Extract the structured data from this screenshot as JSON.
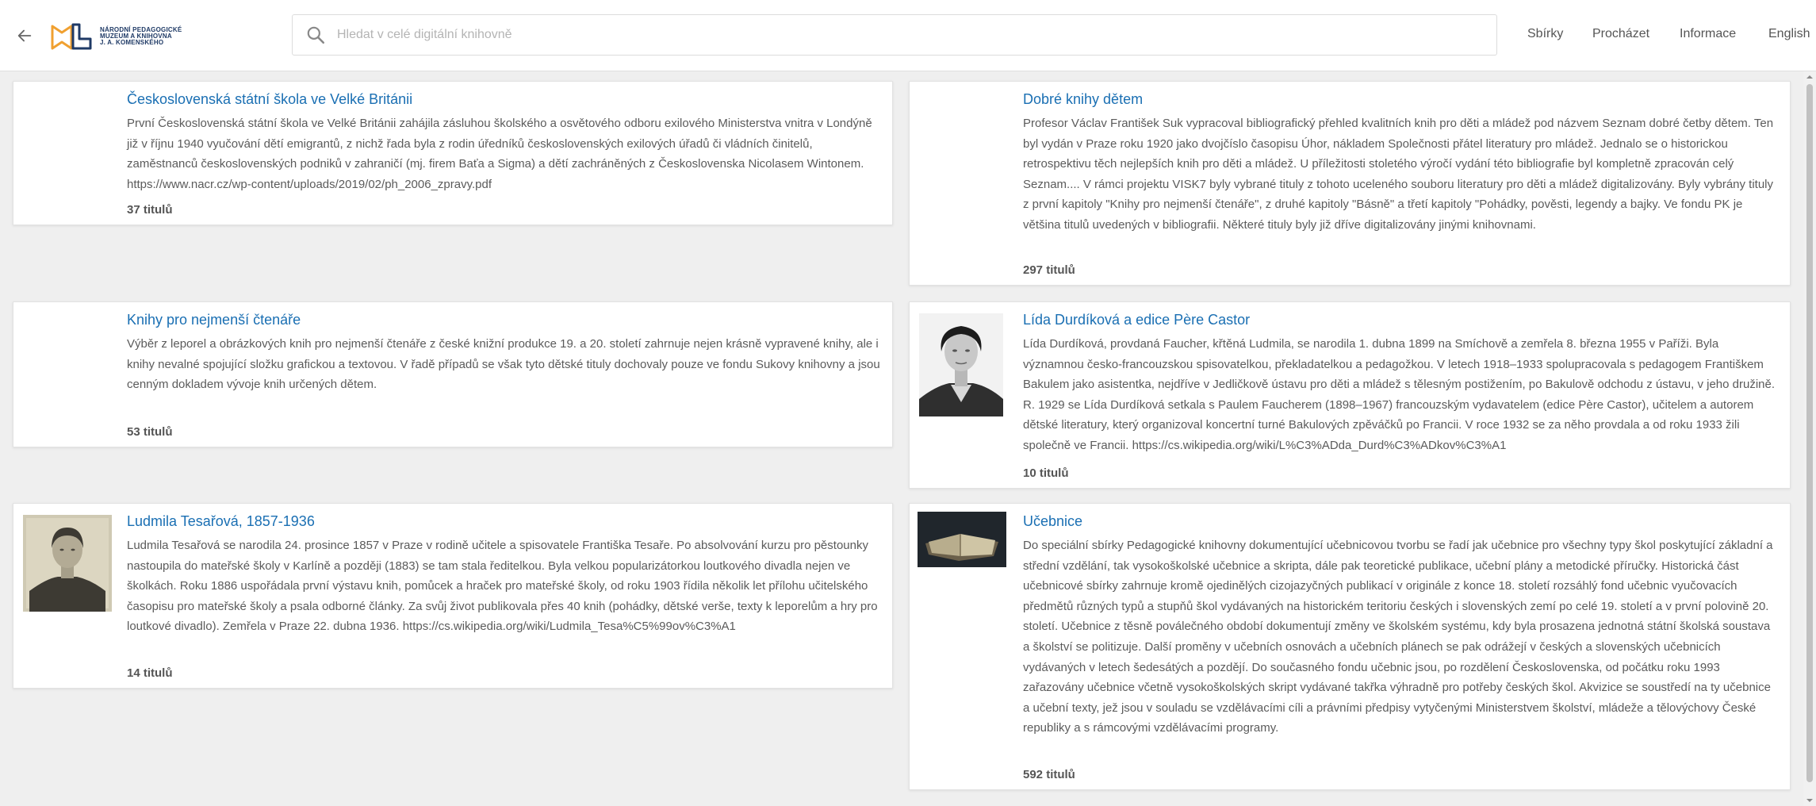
{
  "header": {
    "logo": {
      "line1": "NÁRODNÍ PEDAGOGICKÉ",
      "line2": "MUZEUM A KNIHOVNA",
      "line3": "J. A. KOMENSKÉHO"
    },
    "search": {
      "placeholder": "Hledat v celé digitální knihovně",
      "value": ""
    },
    "nav": {
      "collections": "Sbírky",
      "browse": "Procházet",
      "info": "Informace",
      "language": "English"
    }
  },
  "collections": [
    {
      "title": "Československá státní škola ve Velké Británii",
      "description": "První Československá státní škola ve Velké Británii zahájila zásluhou školského a osvětového odboru exilového Ministerstva vnitra v Londýně již v říjnu 1940 vyučování dětí emigrantů, z nichž řada byla z rodin úředníků československých exilových úřadů či vládních činitelů, zaměstnanců československých podniků v zahraničí (mj. firem Baťa a Sigma) a dětí zachráněných z Československa Nicolasem Wintonem. https://www.nacr.cz/wp-content/uploads/2019/02/ph_2006_zpravy.pdf",
      "count": "37 titulů"
    },
    {
      "title": "Dobré knihy dětem",
      "description": "Profesor Václav František Suk vypracoval bibliografický přehled kvalitních knih pro děti a mládež pod názvem Seznam dobré četby dětem. Ten byl vydán v Praze roku 1920 jako dvojčíslo časopisu Úhor, nákladem Společnosti přátel literatury pro mládež. Jednalo se o historickou retrospektivu těch nejlepších knih pro děti a mládež. U příležitosti stoletého výročí vydání této bibliografie byl kompletně zpracován celý Seznam.... V rámci projektu VISK7 byly vybrané tituly z tohoto uceleného souboru literatury pro děti a mládež digitalizovány. Byly vybrány tituly z první kapitoly \"Knihy pro nejmenší čtenáře\", z druhé kapitoly \"Básně\" a třetí kapitoly \"Pohádky, pověsti, legendy a bajky. Ve fondu PK je většina titulů uvedených v bibliografii. Některé tituly byly již dříve digitalizovány jinými knihovnami.",
      "count": "297 titulů"
    },
    {
      "title": "Knihy pro nejmenší čtenáře",
      "description": "Výběr z leporel a obrázkových knih pro nejmenší čtenáře z české knižní produkce 19. a 20. století zahrnuje nejen krásně vypravené knihy, ale i knihy nevalné spojující složku grafickou a textovou. V řadě případů se však tyto dětské tituly dochovaly pouze ve fondu Sukovy knihovny a jsou cenným dokladem vývoje knih určených dětem.",
      "count": "53 titulů"
    },
    {
      "title": "Lída Durdíková a edice Père Castor",
      "description": "Lída Durdíková, provdaná Faucher, křtěná Ludmila, se narodila 1. dubna 1899 na Smíchově a zemřela 8. března 1955 v Paříži. Byla významnou česko-francouzskou spisovatelkou, překladatelkou a pedagožkou. V letech 1918–1933 spolupracovala s pedagogem Františkem Bakulem jako asistentka, nejdříve v Jedličkově ústavu pro děti a mládež s tělesným postižením, po Bakulově odchodu z ústavu, v jeho družině. R. 1929 se Lída Durdíková setkala s Paulem Faucherem (1898–1967) francouzským vydavatelem (edice Père Castor), učitelem a autorem dětské literatury, který organizoval koncertní turné Bakulových zpěváčků po Francii. V roce 1932 se za něho provdala a od roku 1933 žili společně ve Francii. https://cs.wikipedia.org/wiki/L%C3%ADda_Durd%C3%ADkov%C3%A1",
      "count": "10 titulů"
    },
    {
      "title": "Ludmila Tesařová, 1857-1936",
      "description": "Ludmila Tesařová se narodila 24. prosince 1857 v Praze v rodině učitele a spisovatele Františka Tesaře. Po absolvování kurzu pro pěstounky nastoupila do mateřské školy v Karlíně a později (1883) se tam stala ředitelkou. Byla velkou popularizátorkou loutkového divadla nejen ve školkách. Roku 1886 uspořádala první výstavu knih, pomůcek a hraček pro mateřské školy, od roku 1903 řídila několik let přílohu učitelského časopisu pro mateřské školy a psala odborné články. Za svůj život publikovala přes 40 knih (pohádky, dětské verše, texty k leporelům a hry pro loutkové divadlo). Zemřela v Praze 22. dubna 1936. https://cs.wikipedia.org/wiki/Ludmila_Tesa%C5%99ov%C3%A1",
      "count": "14 titulů"
    },
    {
      "title": "Učebnice",
      "description": "Do speciální sbírky Pedagogické knihovny dokumentující učebnicovou tvorbu se řadí jak učebnice pro všechny typy škol poskytující základní a střední vzdělání, tak vysokoškolské učebnice a skripta, dále pak teoretické publikace, učební plány a metodické příručky. Historická část učebnicové sbírky zahrnuje kromě ojedinělých cizojazyčných publikací v originále z konce 18. století rozsáhlý fond učebnic vyučovacích předmětů různých typů a stupňů škol vydávaných na historickém teritoriu českých i slovenských zemí po celé 19. století a v první polovině 20. století. Učebnice z těsně poválečného období dokumentují změny ve školském systému, kdy byla prosazena jednotná státní školská soustava a školství se politizuje. Další proměny v učebních osnovách a učebních plánech se pak odrážejí v českých a slovenských učebnicích vydávaných v letech šedesátých a pozdějí. Do současného fondu učebnic jsou, po rozdělení Československa, od počátku roku 1993 zařazovány učebnice včetně vysokoškolských skript vydávané takřka výhradně pro potřeby českých škol. Akvizice se soustředí na ty učebnice a učební texty, jež jsou v souladu se vzdělávacími cíli a právními předpisy vytyčenými Ministerstvem školství, mládeže a tělovýchovy České republiky a s rámcovými vzdělávacími programy.",
      "count": "592 titulů"
    }
  ]
}
